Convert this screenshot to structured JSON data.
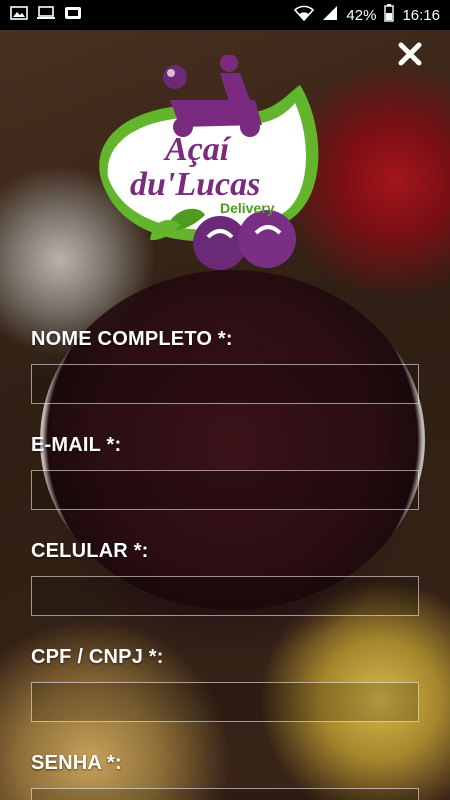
{
  "status_bar": {
    "battery": "42%",
    "time": "16:16",
    "icons": [
      "photo-icon",
      "laptop-icon",
      "sim-icon",
      "wifi-icon",
      "signal-icon",
      "battery-icon"
    ]
  },
  "logo": {
    "line1": "Açaí",
    "line2": "du'Lucas",
    "tagline": "Delivery",
    "green": "#5fb52b",
    "purple": "#7a2a7f"
  },
  "form": {
    "fields": [
      {
        "label": "NOME COMPLETO *:",
        "value": "",
        "placeholder": ""
      },
      {
        "label": "E-MAIL *:",
        "value": "",
        "placeholder": ""
      },
      {
        "label": "CELULAR *:",
        "value": "",
        "placeholder": ""
      },
      {
        "label": "CPF / CNPJ *:",
        "value": "",
        "placeholder": ""
      },
      {
        "label": "SENHA *:",
        "value": "",
        "placeholder": ""
      }
    ]
  }
}
